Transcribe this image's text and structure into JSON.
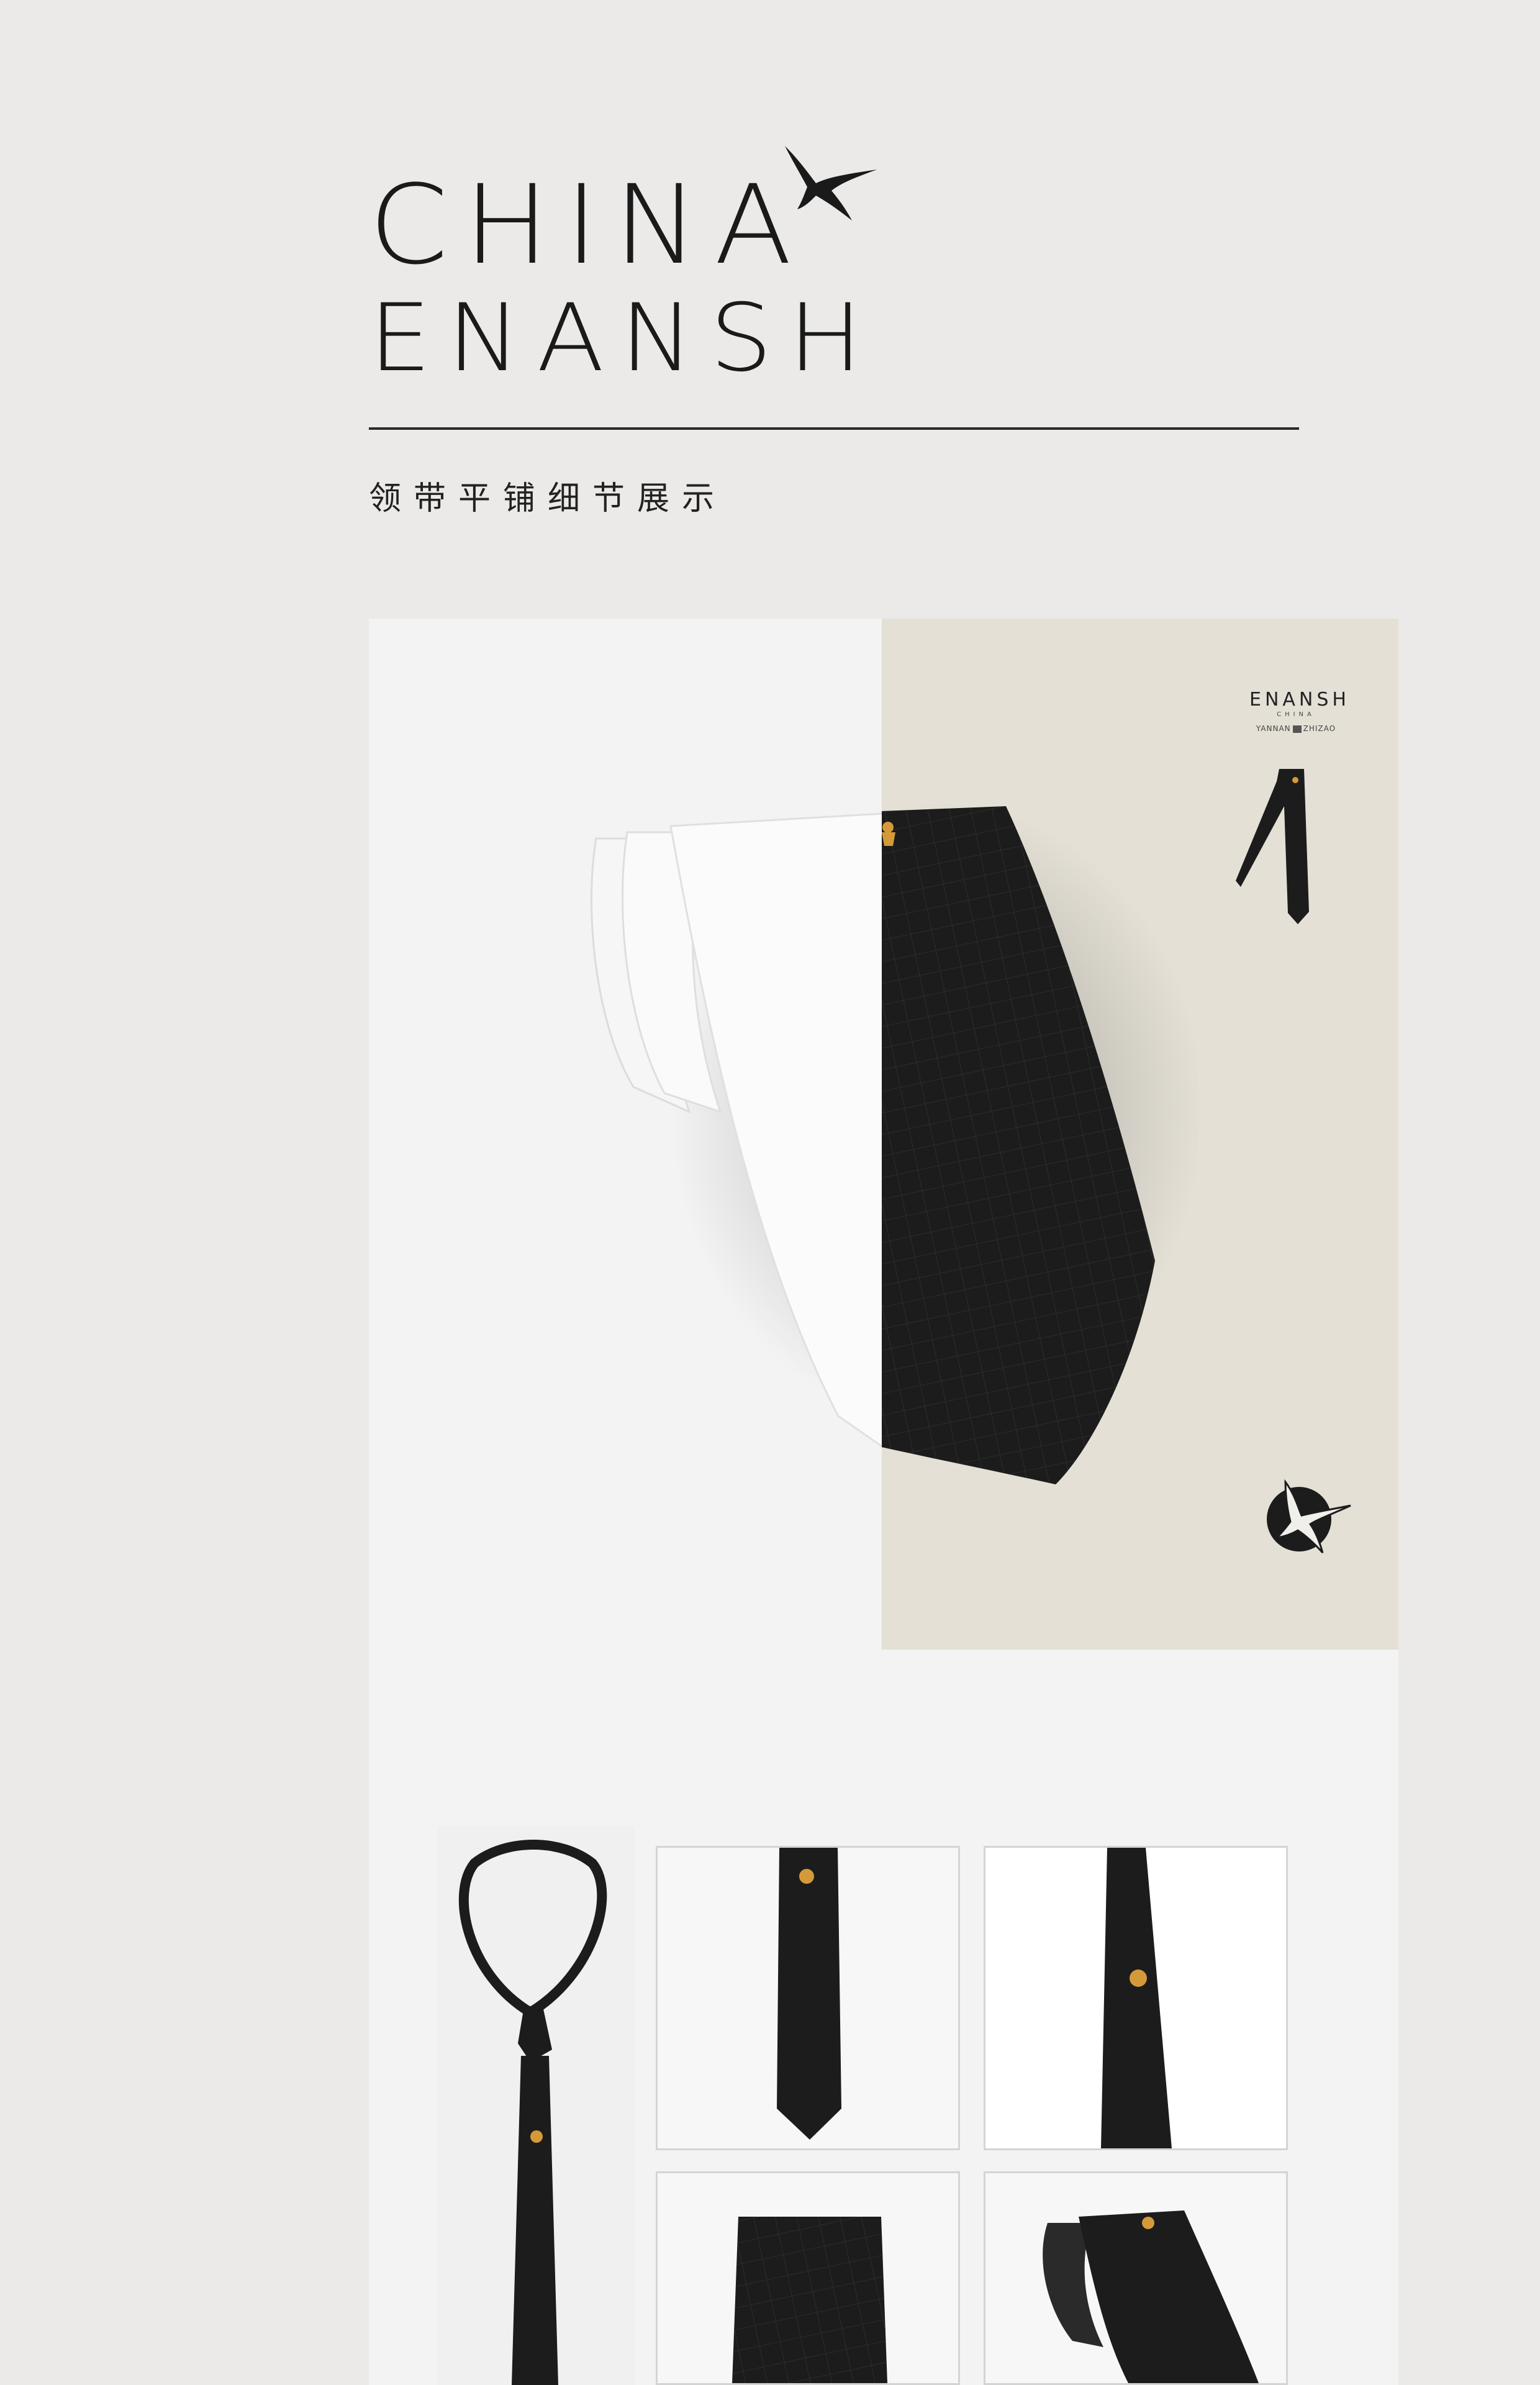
{
  "header": {
    "logo_line1": "CHINA",
    "logo_line2": "ENANSH",
    "subtitle": "领带平铺细节展示"
  },
  "showcase": {
    "brand_name": "ENANSH",
    "brand_sub": "CHINA",
    "brand_left": "YANNAN",
    "brand_right": "ZHIZAO"
  },
  "colors": {
    "page_bg": "#ebeae8",
    "panel_bg": "#f3f3f3",
    "beige_bg": "#e4e0d6",
    "tie_black": "#1c1c1c",
    "emblem_gold": "#d49a3a"
  },
  "icons": [
    "swallow-logo-icon",
    "round-swallow-logo-icon",
    "cat-emblem-icon"
  ]
}
